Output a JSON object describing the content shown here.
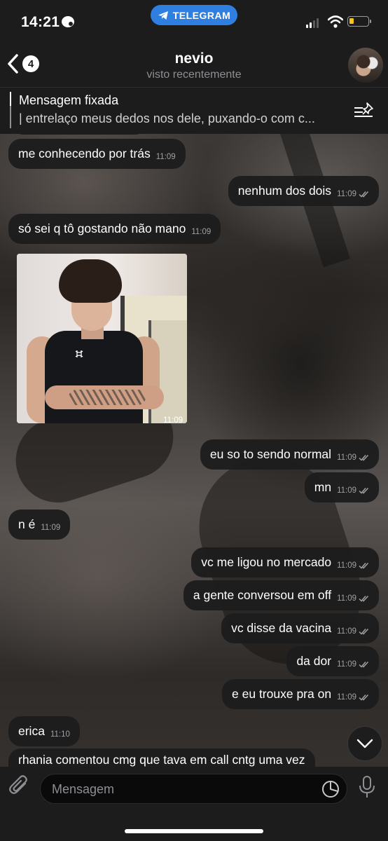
{
  "status_bar": {
    "time": "14:21",
    "app_pill": "TELEGRAM"
  },
  "header": {
    "back_count": "4",
    "name": "nevio",
    "status": "visto recentemente"
  },
  "pinned": {
    "title": "Mensagem fixada",
    "text": "| entrelaço meus dedos nos dele, puxando-o com c..."
  },
  "messages": [
    {
      "text": "me conhecendo por trás",
      "time": "11:09",
      "outgoing": false
    },
    {
      "text": "nenhum dos dois",
      "time": "11:09",
      "outgoing": true,
      "read": true
    },
    {
      "text": "só sei q tô gostando não mano",
      "time": "11:09",
      "outgoing": false
    },
    {
      "photo": true,
      "time": "11:09",
      "outgoing": false
    },
    {
      "text": "eu so to sendo normal",
      "time": "11:09",
      "outgoing": true,
      "read": true
    },
    {
      "text": "mn",
      "time": "11:09",
      "outgoing": true,
      "read": true
    },
    {
      "text": "n é",
      "time": "11:09",
      "outgoing": false
    },
    {
      "text": "vc me ligou no mercado",
      "time": "11:09",
      "outgoing": true,
      "read": true
    },
    {
      "text": "a gente conversou em off",
      "time": "11:09",
      "outgoing": true,
      "read": true
    },
    {
      "text": "vc disse da vacina",
      "time": "11:09",
      "outgoing": true,
      "read": true
    },
    {
      "text": "da dor",
      "time": "11:09",
      "outgoing": true,
      "read": true
    },
    {
      "text": "e eu trouxe pra on",
      "time": "11:09",
      "outgoing": true,
      "read": true
    },
    {
      "text": "erica",
      "time": "11:10",
      "outgoing": false
    },
    {
      "text": "rhania comentou cmg que tava em call cntg uma vez",
      "outgoing": false
    }
  ],
  "input": {
    "placeholder": "Mensagem"
  },
  "colors": {
    "bar_bg": "#1c1c1d",
    "bubble_bg": "#1c1c1e",
    "pill": "#2f7fe0",
    "battery": "#f5c518"
  }
}
